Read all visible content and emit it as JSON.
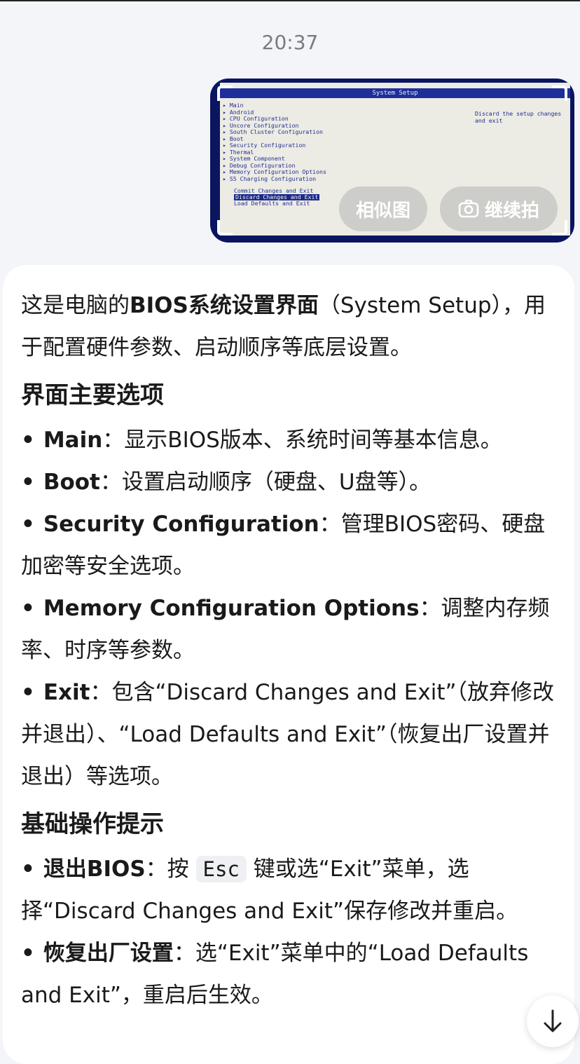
{
  "status": {
    "time": "20:37"
  },
  "thumbnail": {
    "bios_title": "System Setup",
    "menu_items": [
      "Main",
      "Android",
      "CPU Configuration",
      "Uncore Configuration",
      "South Cluster Configuration",
      "Boot",
      "Security Configuration",
      "Thermal",
      "System Component",
      "Debug Configuration",
      "Memory Configuration Options",
      "S5 Charging Configuration"
    ],
    "exit_items": [
      "Commit Changes and Exit",
      "Discard Changes and Exit",
      "Load Defaults and Exit"
    ],
    "help_text": "Discard the setup changes and exit",
    "similar_label": "相似图",
    "continue_label": "继续拍"
  },
  "answer": {
    "intro_1": "这是电脑的",
    "intro_bold": "BIOS系统设置界面",
    "intro_2": "（System Setup），用于配置硬件参数、启动顺序等底层设置。",
    "heading_options": "界面主要选项",
    "options": [
      {
        "term": "Main",
        "desc": "：显示BIOS版本、系统时间等基本信息。"
      },
      {
        "term": "Boot",
        "desc": "：设置启动顺序（硬盘、U盘等）。"
      },
      {
        "term": "Security Configuration",
        "desc": "：管理BIOS密码、硬盘加密等安全选项。"
      },
      {
        "term": "Memory Configuration Options",
        "desc": "：调整内存频率、时序等参数。"
      },
      {
        "term": "Exit",
        "desc": "：包含“Discard Changes and Exit”（放弃修改并退出）、“Load Defaults and Exit”（恢复出厂设置并退出）等选项。"
      }
    ],
    "heading_tips": "基础操作提示",
    "tip1_term": "退出BIOS",
    "tip1_pre": "：按",
    "tip1_key": "Esc",
    "tip1_post": "键或选“Exit”菜单，选择“Discard Changes and Exit”保存修改并重启。",
    "tip2_term": "恢复出厂设置",
    "tip2_desc": "：选“Exit”菜单中的“Load Defaults and Exit”，重启后生效。"
  },
  "icons": {
    "scroll_down": "arrow-down-icon",
    "camera": "camera-icon"
  }
}
